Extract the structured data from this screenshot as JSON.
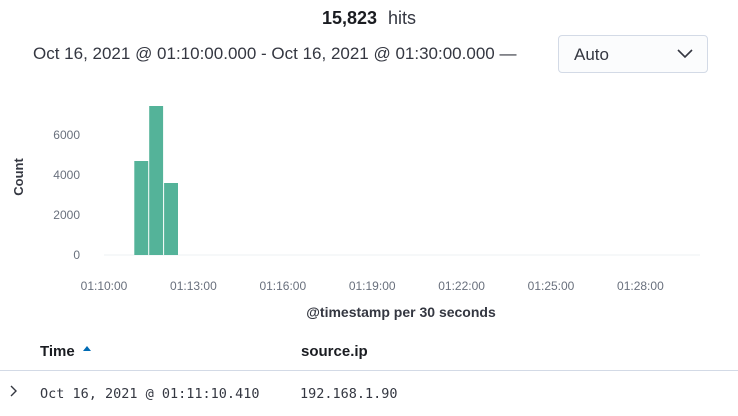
{
  "hits": {
    "count": "15,823",
    "label": "hits"
  },
  "time_range": {
    "text": "Oct 16, 2021 @ 01:10:00.000 - Oct 16, 2021 @ 01:30:00.000 —"
  },
  "interval": {
    "selected": "Auto"
  },
  "chart_data": {
    "type": "bar",
    "xlabel": "@timestamp per 30 seconds",
    "ylabel": "Count",
    "x_ticks": [
      "01:10:00",
      "01:13:00",
      "01:16:00",
      "01:19:00",
      "01:22:00",
      "01:25:00",
      "01:28:00"
    ],
    "y_ticks": [
      "0",
      "2000",
      "4000",
      "6000"
    ],
    "ylim": [
      0,
      8000
    ],
    "x_range": [
      "01:10:00",
      "01:30:00"
    ],
    "categories": [
      "01:11:00",
      "01:11:30",
      "01:12:00"
    ],
    "values": [
      4700,
      7450,
      3600
    ],
    "color": "#54b399",
    "grid": false
  },
  "table": {
    "columns": [
      {
        "label": "Time"
      },
      {
        "label": "source.ip"
      }
    ],
    "rows": [
      {
        "time": "Oct 16, 2021 @ 01:11:10.410",
        "source_ip": "192.168.1.90"
      }
    ]
  }
}
